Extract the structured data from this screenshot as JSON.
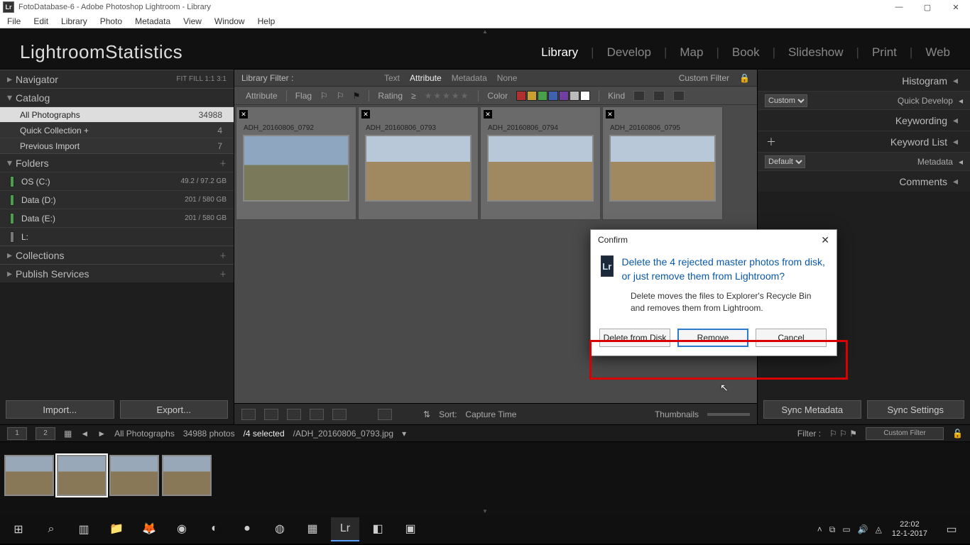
{
  "window": {
    "title": "FotoDatabase-6 - Adobe Photoshop Lightroom - Library"
  },
  "menu": [
    "File",
    "Edit",
    "Library",
    "Photo",
    "Metadata",
    "View",
    "Window",
    "Help"
  ],
  "identity": "LightroomStatistics",
  "modules": {
    "items": [
      "Library",
      "Develop",
      "Map",
      "Book",
      "Slideshow",
      "Print",
      "Web"
    ],
    "active": "Library"
  },
  "left": {
    "navigator": {
      "label": "Navigator",
      "modes": "FIT   FILL   1:1   3:1"
    },
    "catalog": {
      "label": "Catalog",
      "rows": [
        {
          "label": "All Photographs",
          "value": "34988",
          "selected": true
        },
        {
          "label": "Quick Collection  +",
          "value": "4"
        },
        {
          "label": "Previous Import",
          "value": "7"
        }
      ]
    },
    "folders": {
      "label": "Folders",
      "rows": [
        {
          "label": "OS (C:)",
          "value": "49.2 / 97.2 GB"
        },
        {
          "label": "Data (D:)",
          "value": "201 / 580 GB"
        },
        {
          "label": "Data (E:)",
          "value": "201 / 580 GB"
        },
        {
          "label": "L:",
          "value": ""
        }
      ]
    },
    "collections": "Collections",
    "publish": "Publish Services",
    "import": "Import...",
    "export": "Export..."
  },
  "filter": {
    "label": "Library Filter :",
    "tabs": [
      "Text",
      "Attribute",
      "Metadata",
      "None"
    ],
    "active": "Attribute",
    "preset": "Custom Filter"
  },
  "attr": {
    "label": "Attribute",
    "flag": "Flag",
    "rating": "Rating",
    "color": "Color",
    "kind": "Kind",
    "swatches": [
      "#b03030",
      "#c8a030",
      "#4aa04a",
      "#4060b0",
      "#7040a0",
      "#bbbbbb",
      "#ffffff"
    ]
  },
  "thumbs": [
    {
      "name": "ADH_20160806_0792"
    },
    {
      "name": "ADH_20160806_0793"
    },
    {
      "name": "ADH_20160806_0794"
    },
    {
      "name": "ADH_20160806_0795"
    }
  ],
  "gridbar": {
    "sort_label": "Sort:",
    "sort_value": "Capture Time",
    "thumbnails": "Thumbnails"
  },
  "right": {
    "histogram": "Histogram",
    "quickdev": "Quick Develop",
    "quickdev_preset": "Custom",
    "keywording": "Keywording",
    "keywordlist": "Keyword List",
    "metadata": "Metadata",
    "metadata_preset": "Default",
    "comments": "Comments",
    "sync_meta": "Sync Metadata",
    "sync_settings": "Sync Settings"
  },
  "info": {
    "path_label": "All Photographs",
    "count": "34988 photos",
    "selected": "/4 selected",
    "filename": "/ADH_20160806_0793.jpg",
    "filter_label": "Filter :",
    "filter_value": "Custom Filter"
  },
  "dialog": {
    "title": "Confirm",
    "msg": "Delete the 4 rejected master photos from disk, or just remove them from Lightroom?",
    "sub": "Delete moves the files to Explorer's Recycle Bin and removes them from Lightroom.",
    "btn_delete": "Delete from Disk",
    "btn_remove": "Remove",
    "btn_cancel": "Cancel"
  },
  "taskbar": {
    "time": "22:02",
    "date": "12-1-2017"
  }
}
